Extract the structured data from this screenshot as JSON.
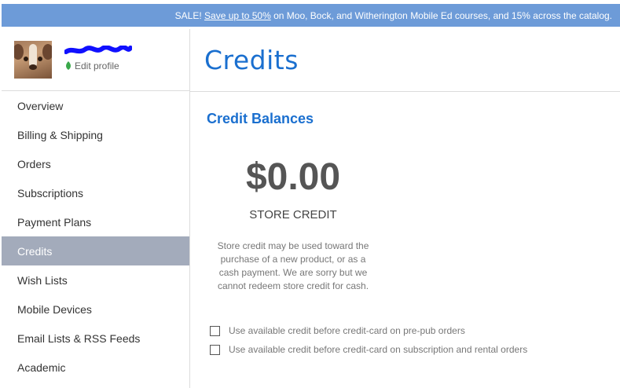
{
  "banner": {
    "prefix": "SALE!",
    "link": "Save up to 50%",
    "suffix": "on Moo, Bock, and Witherington Mobile Ed courses, and 15% across the catalog."
  },
  "profile": {
    "edit_label": "Edit profile",
    "redaction_color": "#1010ff"
  },
  "sidebar": {
    "items": [
      {
        "label": "Overview",
        "active": false
      },
      {
        "label": "Billing & Shipping",
        "active": false
      },
      {
        "label": "Orders",
        "active": false
      },
      {
        "label": "Subscriptions",
        "active": false
      },
      {
        "label": "Payment Plans",
        "active": false
      },
      {
        "label": "Credits",
        "active": true
      },
      {
        "label": "Wish Lists",
        "active": false
      },
      {
        "label": "Mobile Devices",
        "active": false
      },
      {
        "label": "Email Lists & RSS Feeds",
        "active": false
      },
      {
        "label": "Academic",
        "active": false
      }
    ]
  },
  "main": {
    "title": "Credits",
    "section_heading": "Credit Balances",
    "balance": "$0.00",
    "balance_label": "STORE CREDIT",
    "note_lines": [
      "Store credit may be used toward the",
      "purchase of a new product, or as a",
      "cash payment. We are sorry but we",
      "cannot redeem store credit for cash."
    ],
    "options": [
      {
        "label": "Use available credit before credit-card on pre-pub orders",
        "checked": false
      },
      {
        "label": "Use available credit before credit-card on subscription and rental orders",
        "checked": false
      }
    ]
  },
  "colors": {
    "banner_bg": "#6d9bd8",
    "accent": "#1a6fcf",
    "active_nav_bg": "#a3abbb"
  }
}
